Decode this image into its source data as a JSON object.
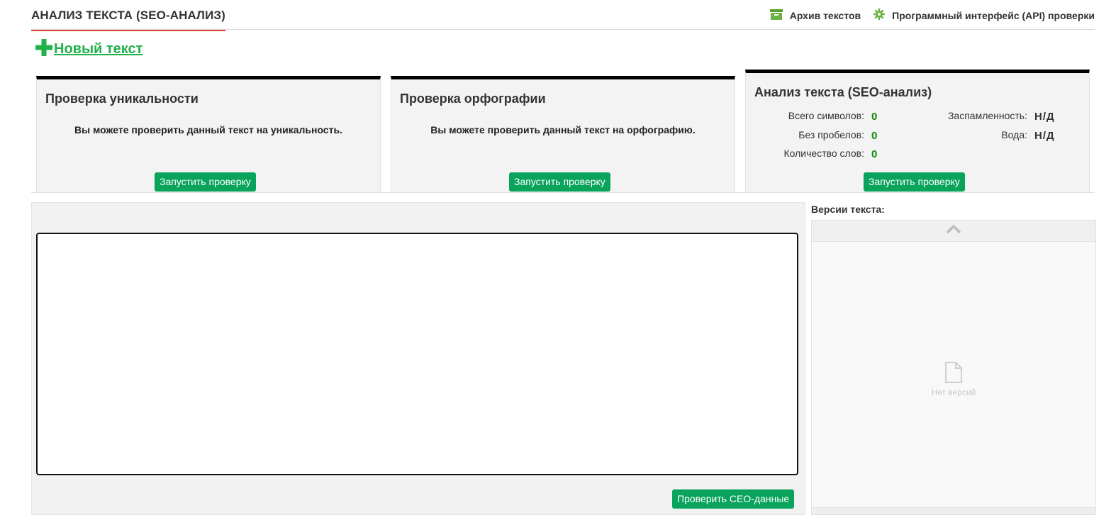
{
  "header": {
    "title": "АНАЛИЗ ТЕКСТА (SEO-АНАЛИЗ)",
    "archive_label": "Архив текстов",
    "api_label": "Программный интерфейс (API) проверки"
  },
  "new_text": {
    "label": "Новый текст"
  },
  "panels": {
    "uniqueness": {
      "title": "Проверка уникальности",
      "description": "Вы можете проверить данный текст на уникальность.",
      "button": "Запустить проверку"
    },
    "spelling": {
      "title": "Проверка орфографии",
      "description": "Вы можете проверить данный текст на орфографию.",
      "button": "Запустить проверку"
    },
    "seo": {
      "title": "Анализ текста (SEO-анализ)",
      "stats": {
        "total_chars_label": "Всего символов:",
        "total_chars_value": "0",
        "no_spaces_label": "Без пробелов:",
        "no_spaces_value": "0",
        "word_count_label": "Количество слов:",
        "word_count_value": "0",
        "spam_label": "Заспамленность:",
        "spam_value": "Н/Д",
        "water_label": "Вода:",
        "water_value": "Н/Д"
      },
      "button": "Запустить проверку"
    }
  },
  "editor": {
    "check_button": "Проверить СЕО-данные"
  },
  "versions": {
    "label": "Версии текста:",
    "empty_text": "Нет версий"
  },
  "colors": {
    "accent_green": "#09a35c",
    "title_underline": "#e0453a",
    "new_text_green": "#21b14b",
    "stat_value_green": "#0c8a0c"
  }
}
